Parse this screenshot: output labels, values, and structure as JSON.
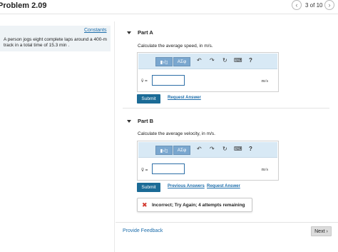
{
  "header": {
    "title": "Problem 2.09",
    "prev_glyph": "‹",
    "next_glyph": "›",
    "pager": "3 of 10"
  },
  "sidebar": {
    "constants_link": "Constants",
    "problem_text": "A person jogs eight complete laps around a 400-m track in a total time of 15.3 min ."
  },
  "toolbar": {
    "templates_glyph": "▮√▯",
    "greek_label": "ΑΣφ",
    "undo_glyph": "↶",
    "redo_glyph": "↷",
    "reset_glyph": "↻",
    "keyboard_glyph": "⌨",
    "help_glyph": "?"
  },
  "part_a": {
    "title": "Part A",
    "instruction": "Calculate the average speed, in m/s.",
    "variable": "v̄ =",
    "units": "m/s",
    "input_value": "",
    "submit": "Submit",
    "request_answer": "Request Answer"
  },
  "part_b": {
    "title": "Part B",
    "instruction": "Calculate the average velocity, in m/s.",
    "variable": "v⃗ =",
    "units": "m/s",
    "input_value": "",
    "submit": "Submit",
    "previous_answers": "Previous Answers",
    "request_answer": "Request Answer",
    "feedback": "Incorrect; Try Again; 4 attempts remaining",
    "feedback_icon": "✖"
  },
  "footer": {
    "provide_feedback": "Provide Feedback",
    "next_label": "Next",
    "next_glyph": "›"
  },
  "colors": {
    "link": "#1c6dab",
    "submit_bg": "#1b6b96",
    "toolbar_bg": "#d8e9f5",
    "error": "#d33a2f"
  }
}
